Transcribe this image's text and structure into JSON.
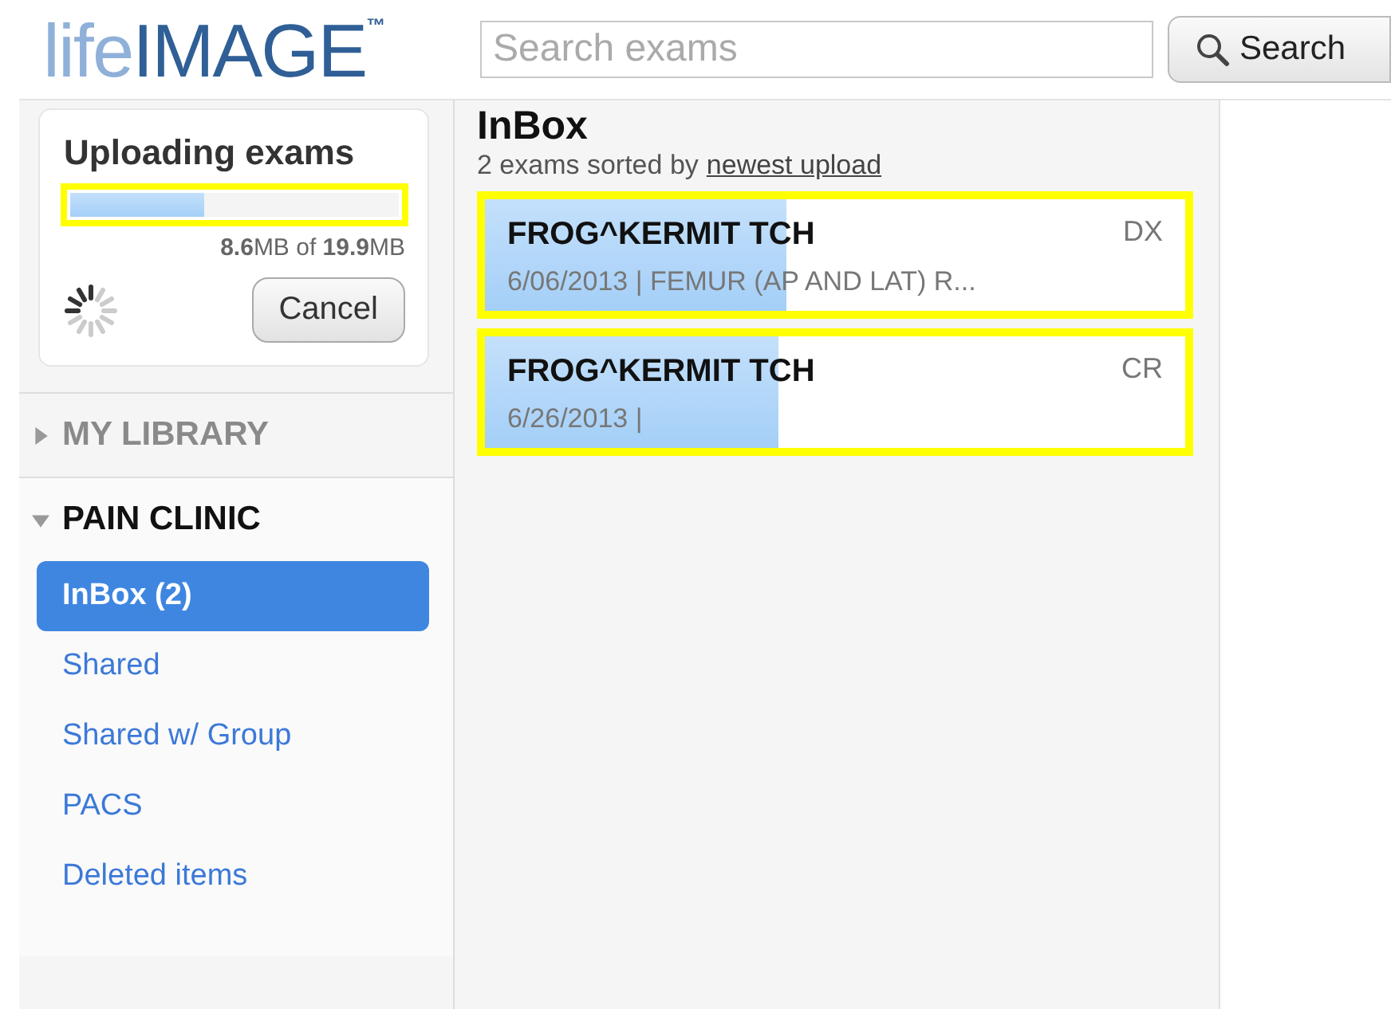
{
  "logo": {
    "light": "life",
    "strong": "IMAGE",
    "mark": "™"
  },
  "search": {
    "placeholder": "Search exams",
    "button": "Search"
  },
  "upload": {
    "title": "Uploading exams",
    "level": 0.41,
    "size": "**8.6**MB of **19.9**MB",
    "cancel": "Cancel"
  },
  "sidebar": {
    "sections": [
      {
        "title": "MY LIBRARY",
        "expanded": false
      },
      {
        "title": "PAIN CLINIC",
        "expanded": true,
        "items": [
          {
            "label": "InBox (2)",
            "selected": true
          },
          {
            "label": "Shared",
            "selected": false
          },
          {
            "label": "Shared w/ Group",
            "selected": false
          },
          {
            "label": "PACS",
            "selected": false
          },
          {
            "label": "Deleted items",
            "selected": false
          }
        ]
      }
    ]
  },
  "inbox": {
    "title": "InBox",
    "summary": "2 exams sorted by",
    "sort_link": "newest upload",
    "exams": [
      {
        "patient": "FROG^KERMIT TCH",
        "details": "6/06/2013 | FEMUR (AP AND LAT) R...",
        "modality": "DX",
        "level": 0.43,
        "highlighted": true
      },
      {
        "patient": "FROG^KERMIT TCH",
        "details": "6/26/2013 |",
        "modality": "CR",
        "level": 0.42,
        "highlighted": true
      }
    ]
  }
}
